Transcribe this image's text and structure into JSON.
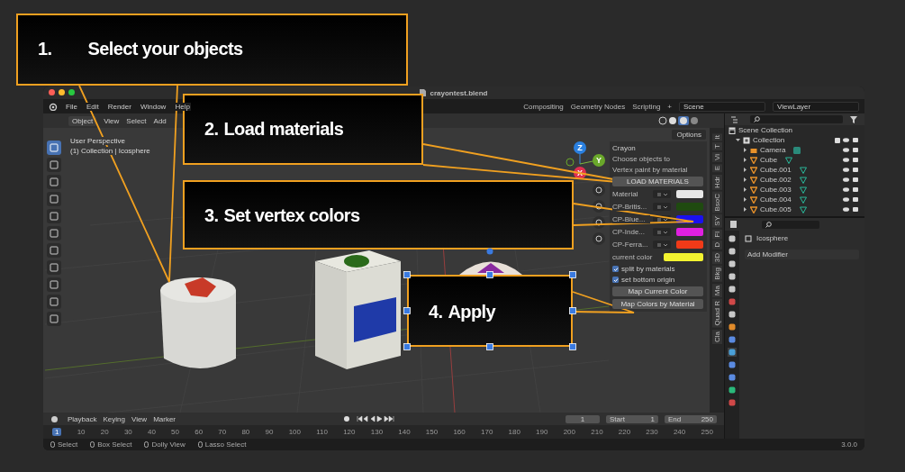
{
  "window": {
    "title": "crayontest.blend"
  },
  "menu": [
    "File",
    "Edit",
    "Render",
    "Window",
    "Help"
  ],
  "workspace_tabs": [
    "Compositing",
    "Geometry Nodes",
    "Scripting",
    "+"
  ],
  "scene": "Scene",
  "view_layer": "ViewLayer",
  "viewport": {
    "mode": "Object",
    "menus": [
      "View",
      "Select",
      "Add"
    ],
    "options": "Options",
    "overlay": [
      "User Perspective",
      "(1) Collection | Icosphere"
    ],
    "gizmo_axes": [
      "Z",
      "Y",
      "X"
    ]
  },
  "crayon_panel": {
    "title": "Crayon",
    "lines": [
      "Choose objects to",
      "Vertex paint by material"
    ],
    "load_button": "LOAD MATERIALS",
    "materials": [
      {
        "name": "Material",
        "color": "#e8e8e8"
      },
      {
        "name": "CP-Britis...",
        "color": "#1f4a10"
      },
      {
        "name": "CP-Blue...",
        "color": "#1a10f0"
      },
      {
        "name": "CP-Inde...",
        "color": "#e020e0"
      },
      {
        "name": "CP-Ferra...",
        "color": "#f03a18"
      }
    ],
    "current_color": {
      "label": "current color",
      "color": "#f4f430"
    },
    "options": [
      {
        "label": "split by materials",
        "checked": true
      },
      {
        "label": "set bottom origin",
        "checked": true
      }
    ],
    "buttons": [
      "Map Current Color",
      "Map Colors by Material"
    ]
  },
  "sidebar_tabs": [
    "It",
    "T",
    "Vi",
    "E",
    "Hdr",
    "BsoC",
    "SY",
    "Fl",
    "D",
    "3D",
    "Bkg",
    "Ma",
    "Quad R",
    "Cla"
  ],
  "outliner": {
    "items": [
      {
        "name": "Scene Collection",
        "kind": "scene",
        "children": [
          {
            "name": "Collection",
            "kind": "collection",
            "expanded": true,
            "checked": true,
            "children": [
              {
                "name": "Camera",
                "kind": "camera",
                "expanded": false
              },
              {
                "name": "Cube",
                "kind": "mesh",
                "expanded": false
              },
              {
                "name": "Cube.001",
                "kind": "mesh",
                "expanded": false
              },
              {
                "name": "Cube.002",
                "kind": "mesh",
                "expanded": false
              },
              {
                "name": "Cube.003",
                "kind": "mesh",
                "expanded": false
              },
              {
                "name": "Cube.004",
                "kind": "mesh",
                "expanded": false
              },
              {
                "name": "Cube.005",
                "kind": "mesh",
                "expanded": false
              }
            ]
          }
        ]
      }
    ]
  },
  "properties": {
    "object": "Icosphere",
    "add_modifier": "Add Modifier"
  },
  "timeline": {
    "menus": [
      "Playback",
      "Keying",
      "View",
      "Marker"
    ],
    "current_frame": "1",
    "start_label": "Start",
    "start": "1",
    "end_label": "End",
    "end": "250",
    "ruler": [
      "1",
      "10",
      "20",
      "30",
      "40",
      "50",
      "60",
      "70",
      "80",
      "90",
      "100",
      "110",
      "120",
      "130",
      "140",
      "150",
      "160",
      "170",
      "180",
      "190",
      "200",
      "210",
      "220",
      "230",
      "240",
      "250"
    ]
  },
  "status_bar": {
    "actions": [
      "Select",
      "Box Select",
      "Dolly View",
      "Lasso Select"
    ],
    "version": "3.0.0"
  },
  "callouts": [
    {
      "number": "1.",
      "text": "Select your objects"
    },
    {
      "number": "2.",
      "text": "Load materials"
    },
    {
      "number": "3.",
      "text": "Set vertex colors"
    },
    {
      "number": "4.",
      "text": "Apply"
    }
  ]
}
